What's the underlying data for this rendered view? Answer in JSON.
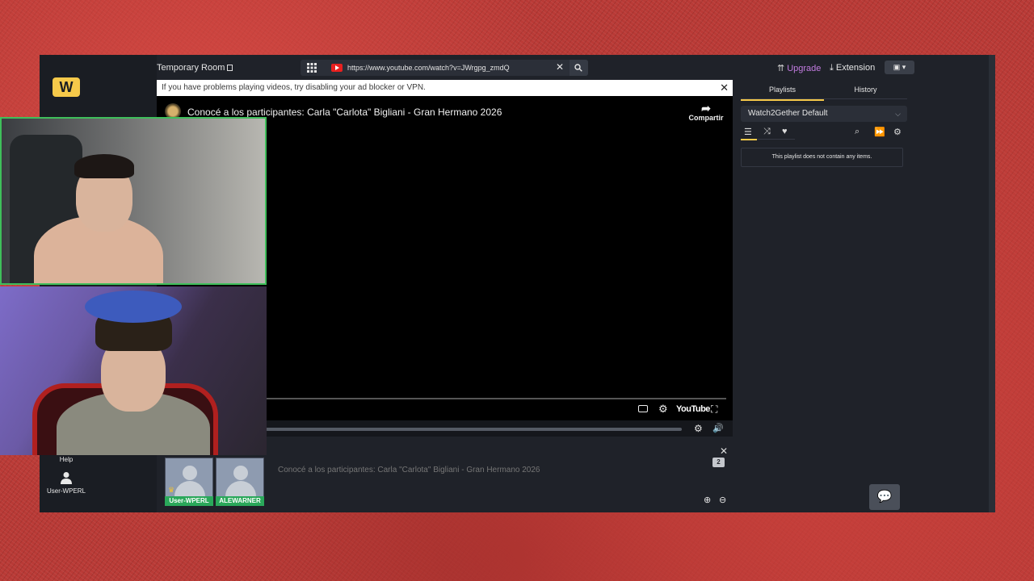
{
  "topbar": {
    "room_title": "Temporary Room",
    "url_value": "https://www.youtube.com/watch?v=JWrgpg_zmdQ",
    "upgrade_label": "Upgrade",
    "extension_label": "Extension",
    "cam_toggle_label": "▣ ▾"
  },
  "notice": {
    "text": "If you have problems playing videos, try disabling your ad blocker or VPN."
  },
  "player": {
    "video_title": "Conocé a los participantes: Carla \"Carlota\" Bigliani - Gran Hermano 2026",
    "share_label": "Compartir",
    "youtube_label": "YouTube"
  },
  "left_rail": {
    "help_label": "Help",
    "user_label": "User-WPERL"
  },
  "room": {
    "users": [
      {
        "name": "User-WPERL",
        "host": true
      },
      {
        "name": "ALEWARNER",
        "host": false
      }
    ],
    "user_count": "2",
    "chat_placeholder": "Conocé a los participantes: Carla \"Carlota\" Bigliani - Gran Hermano 2026"
  },
  "playlist": {
    "tabs": [
      "Playlists",
      "History"
    ],
    "active_tab": "Playlists",
    "selected_playlist": "Watch2Gether Default",
    "empty_message": "This playlist does not contain any items."
  },
  "colors": {
    "accent": "#f6c94a",
    "upgrade": "#c27ce0",
    "user_tag": "#2aa85a",
    "app_bg": "#1f2229"
  },
  "icons": {
    "logo": "w2g-logo",
    "grid": "grid-icon",
    "youtube": "youtube-icon",
    "close": "close-icon",
    "search": "search-icon",
    "upgrade": "upgrade-icon",
    "extension": "download-icon",
    "share": "share-arrow-icon",
    "captions": "captions-icon",
    "settings": "gear-icon",
    "fullscreen": "fullscreen-icon",
    "volume": "volume-icon",
    "zoom_in": "zoom-in-icon",
    "zoom_out": "zoom-out-icon",
    "playlist_list": "list-icon",
    "shuffle": "shuffle-icon",
    "heart": "heart-icon",
    "skip": "skip-forward-icon",
    "chat": "chat-bubbles-icon",
    "user": "user-icon"
  }
}
